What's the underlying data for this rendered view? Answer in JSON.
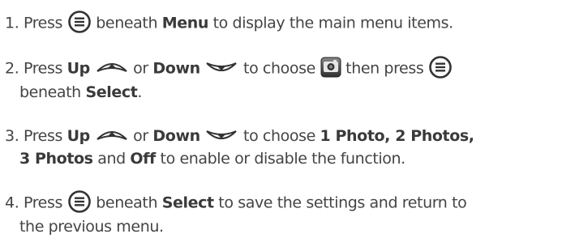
{
  "steps": [
    {
      "number": "1.",
      "press": "Press",
      "beneath": "beneath",
      "menu": "Menu",
      "tail": "to display the main menu items."
    },
    {
      "number": "2.",
      "press": "Press",
      "up": "Up",
      "or": "or",
      "down": "Down",
      "choose": "to choose",
      "then_press": "then press",
      "beneath": "beneath",
      "select": "Select",
      "end": "."
    },
    {
      "number": "3.",
      "press": "Press",
      "up": "Up",
      "or": "or",
      "down": "Down",
      "choose": "to choose",
      "options_line1": "1 Photo, 2 Photos,",
      "options_line2": "3 Photos",
      "and": "and",
      "off": "Off",
      "tail": "to enable or disable the function."
    },
    {
      "number": "4.",
      "press": "Press",
      "beneath": "beneath",
      "select": "Select",
      "tail_line1": "to save the settings and return to",
      "tail_line2": "the previous menu."
    }
  ],
  "icons": {
    "menu": "menu-button-icon",
    "up": "up-arrow-button-icon",
    "down": "down-arrow-button-icon",
    "camera": "camera-icon"
  },
  "colors": {
    "text": "#444444",
    "icon_stroke": "#333333",
    "camera_body": "#555555"
  }
}
